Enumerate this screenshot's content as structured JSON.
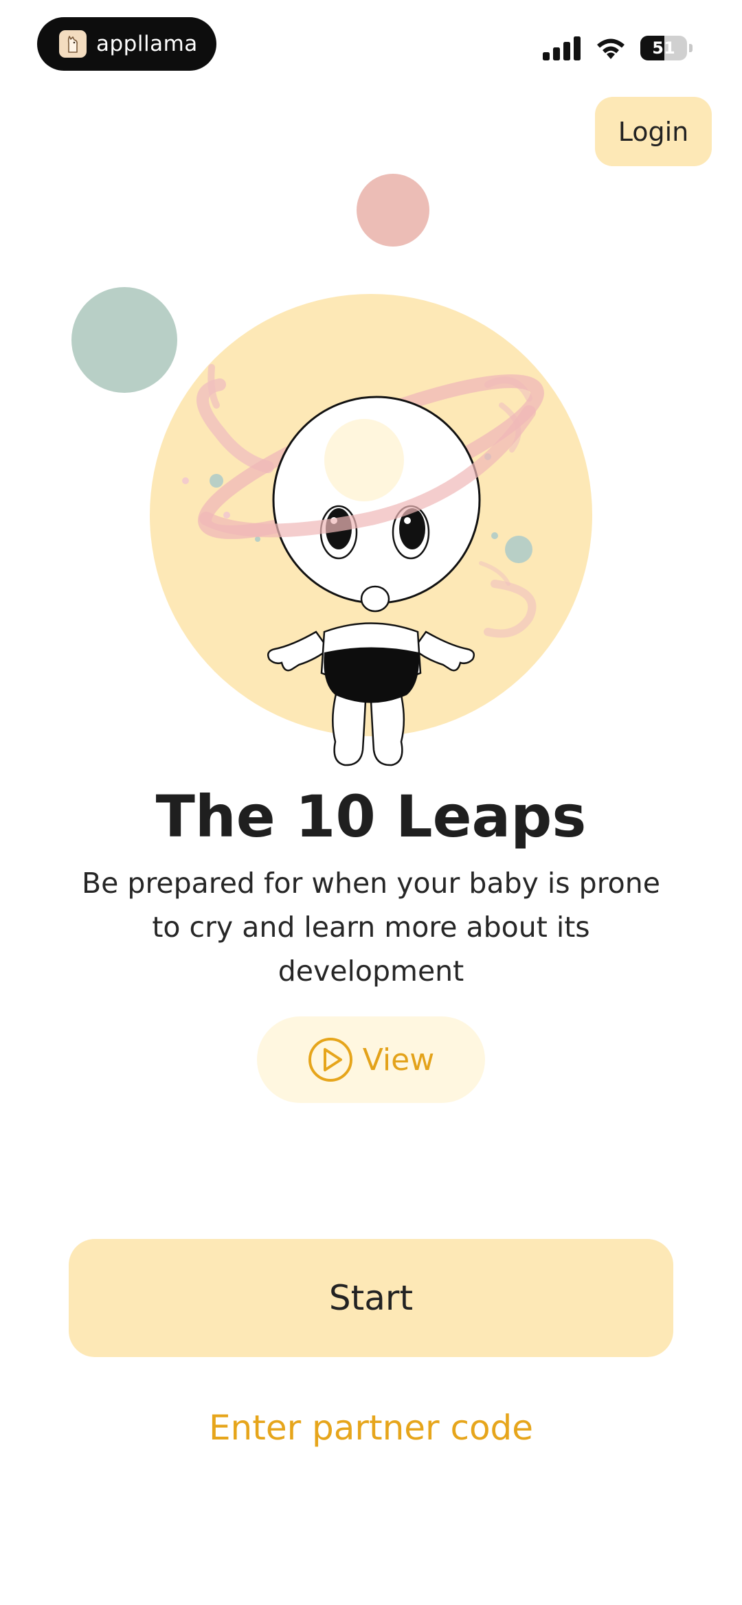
{
  "status_bar": {
    "app_name": "appllama",
    "battery": "51",
    "battery_level": 0.51,
    "icons": [
      "llama-icon",
      "signal-icon",
      "wifi-icon",
      "battery-icon"
    ]
  },
  "header": {
    "login_label": "Login"
  },
  "hero": {
    "illustration": "baby-planet-illustration",
    "title": "The 10 Leaps",
    "description": "Be prepared for when your baby is prone to cry and learn more about its development",
    "view_label": "View",
    "view_icon": "play-circle-icon"
  },
  "actions": {
    "start_label": "Start",
    "partner_code_label": "Enter partner code"
  },
  "colors": {
    "accent": "#e6a51b",
    "button_bg": "#fde8b6",
    "view_bg": "#fff7e0",
    "pink": "#ecbdb6",
    "green": "#b8cfc6",
    "planet": "#fde8b6"
  }
}
